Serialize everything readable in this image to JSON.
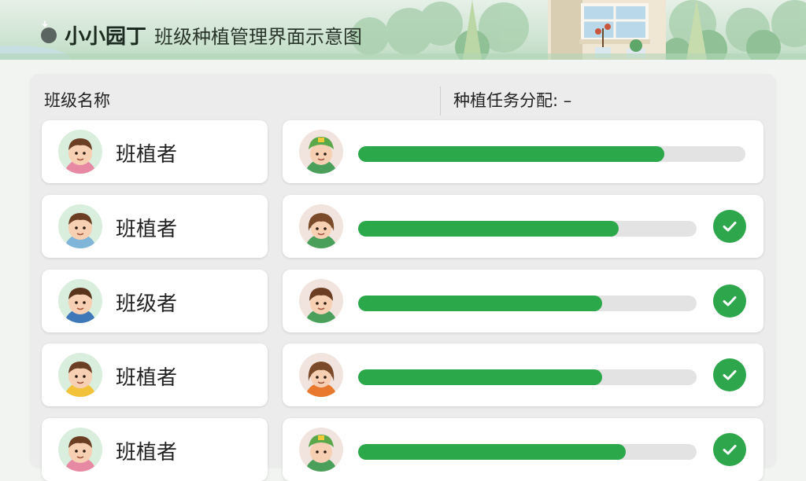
{
  "header": {
    "title": "小小园丁",
    "subtitle": "班级种植管理界面示意图",
    "download_icon": "download-icon"
  },
  "columns": {
    "class_name": "班级名称",
    "task_assignment": "种植任务分配: –"
  },
  "colors": {
    "accent": "#2aa84a",
    "track": "#e3e3e3",
    "check": "#2ea64c"
  },
  "rows": [
    {
      "name": "班植者",
      "progress": 0.79,
      "done": false
    },
    {
      "name": "班植者",
      "progress": 0.77,
      "done": true
    },
    {
      "name": "班级者",
      "progress": 0.72,
      "done": true
    },
    {
      "name": "班植者",
      "progress": 0.72,
      "done": true
    },
    {
      "name": "班植者",
      "progress": 0.79,
      "done": true
    }
  ]
}
